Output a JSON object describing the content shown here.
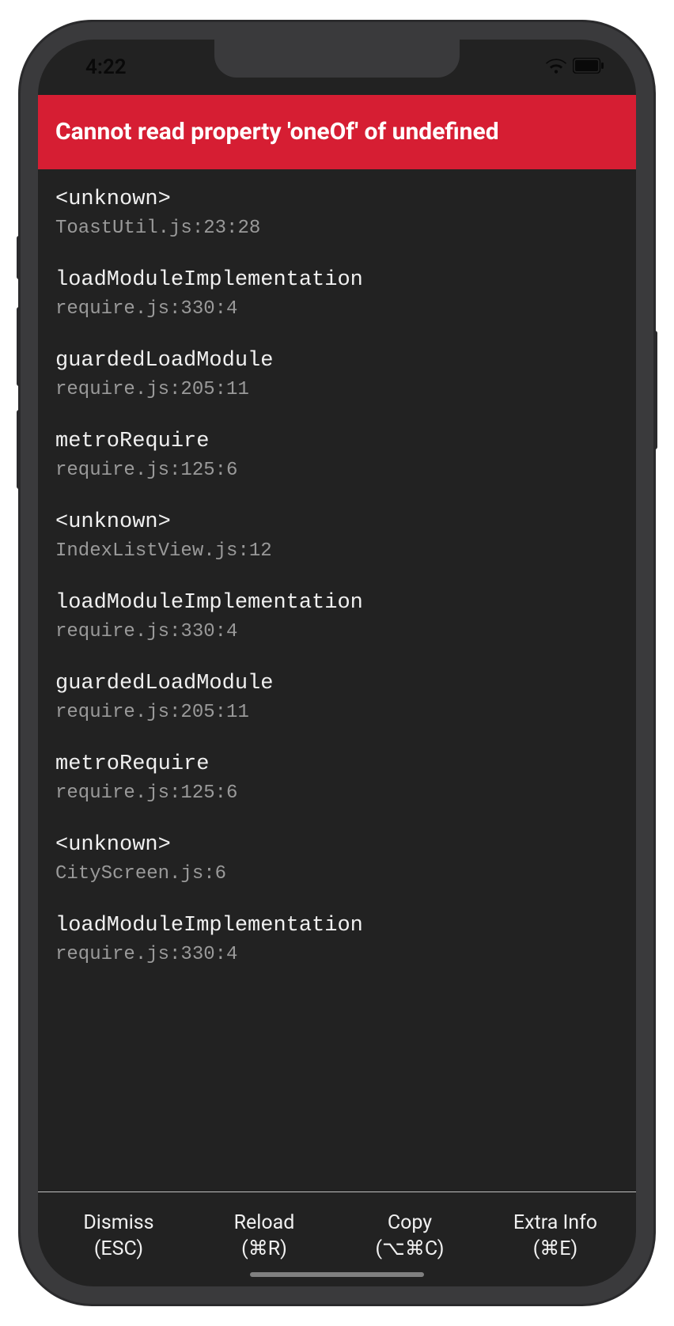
{
  "status_bar": {
    "time": "4:22"
  },
  "error": {
    "message": "Cannot read property 'oneOf' of undefined"
  },
  "stack": [
    {
      "name": "<unknown>",
      "location": "ToastUtil.js:23:28"
    },
    {
      "name": "loadModuleImplementation",
      "location": "require.js:330:4"
    },
    {
      "name": "guardedLoadModule",
      "location": "require.js:205:11"
    },
    {
      "name": "metroRequire",
      "location": "require.js:125:6"
    },
    {
      "name": "<unknown>",
      "location": "IndexListView.js:12"
    },
    {
      "name": "loadModuleImplementation",
      "location": "require.js:330:4"
    },
    {
      "name": "guardedLoadModule",
      "location": "require.js:205:11"
    },
    {
      "name": "metroRequire",
      "location": "require.js:125:6"
    },
    {
      "name": "<unknown>",
      "location": "CityScreen.js:6"
    },
    {
      "name": "loadModuleImplementation",
      "location": "require.js:330:4"
    }
  ],
  "bottom_bar": {
    "dismiss": {
      "label": "Dismiss",
      "shortcut": "(ESC)"
    },
    "reload": {
      "label": "Reload",
      "shortcut": "(⌘R)"
    },
    "copy": {
      "label": "Copy",
      "shortcut": "(⌥⌘C)"
    },
    "extra_info": {
      "label": "Extra Info",
      "shortcut": "(⌘E)"
    }
  }
}
